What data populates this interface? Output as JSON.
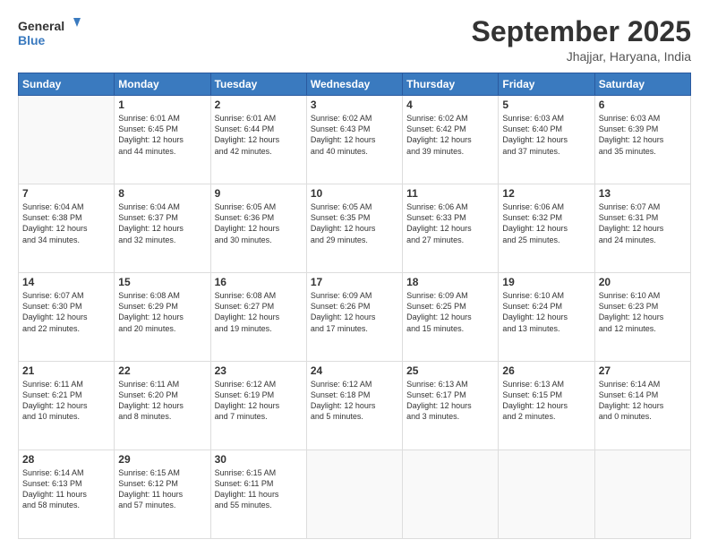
{
  "header": {
    "logo_general": "General",
    "logo_blue": "Blue",
    "month": "September 2025",
    "location": "Jhajjar, Haryana, India"
  },
  "weekdays": [
    "Sunday",
    "Monday",
    "Tuesday",
    "Wednesday",
    "Thursday",
    "Friday",
    "Saturday"
  ],
  "weeks": [
    [
      {
        "day": "",
        "info": ""
      },
      {
        "day": "1",
        "info": "Sunrise: 6:01 AM\nSunset: 6:45 PM\nDaylight: 12 hours\nand 44 minutes."
      },
      {
        "day": "2",
        "info": "Sunrise: 6:01 AM\nSunset: 6:44 PM\nDaylight: 12 hours\nand 42 minutes."
      },
      {
        "day": "3",
        "info": "Sunrise: 6:02 AM\nSunset: 6:43 PM\nDaylight: 12 hours\nand 40 minutes."
      },
      {
        "day": "4",
        "info": "Sunrise: 6:02 AM\nSunset: 6:42 PM\nDaylight: 12 hours\nand 39 minutes."
      },
      {
        "day": "5",
        "info": "Sunrise: 6:03 AM\nSunset: 6:40 PM\nDaylight: 12 hours\nand 37 minutes."
      },
      {
        "day": "6",
        "info": "Sunrise: 6:03 AM\nSunset: 6:39 PM\nDaylight: 12 hours\nand 35 minutes."
      }
    ],
    [
      {
        "day": "7",
        "info": "Sunrise: 6:04 AM\nSunset: 6:38 PM\nDaylight: 12 hours\nand 34 minutes."
      },
      {
        "day": "8",
        "info": "Sunrise: 6:04 AM\nSunset: 6:37 PM\nDaylight: 12 hours\nand 32 minutes."
      },
      {
        "day": "9",
        "info": "Sunrise: 6:05 AM\nSunset: 6:36 PM\nDaylight: 12 hours\nand 30 minutes."
      },
      {
        "day": "10",
        "info": "Sunrise: 6:05 AM\nSunset: 6:35 PM\nDaylight: 12 hours\nand 29 minutes."
      },
      {
        "day": "11",
        "info": "Sunrise: 6:06 AM\nSunset: 6:33 PM\nDaylight: 12 hours\nand 27 minutes."
      },
      {
        "day": "12",
        "info": "Sunrise: 6:06 AM\nSunset: 6:32 PM\nDaylight: 12 hours\nand 25 minutes."
      },
      {
        "day": "13",
        "info": "Sunrise: 6:07 AM\nSunset: 6:31 PM\nDaylight: 12 hours\nand 24 minutes."
      }
    ],
    [
      {
        "day": "14",
        "info": "Sunrise: 6:07 AM\nSunset: 6:30 PM\nDaylight: 12 hours\nand 22 minutes."
      },
      {
        "day": "15",
        "info": "Sunrise: 6:08 AM\nSunset: 6:29 PM\nDaylight: 12 hours\nand 20 minutes."
      },
      {
        "day": "16",
        "info": "Sunrise: 6:08 AM\nSunset: 6:27 PM\nDaylight: 12 hours\nand 19 minutes."
      },
      {
        "day": "17",
        "info": "Sunrise: 6:09 AM\nSunset: 6:26 PM\nDaylight: 12 hours\nand 17 minutes."
      },
      {
        "day": "18",
        "info": "Sunrise: 6:09 AM\nSunset: 6:25 PM\nDaylight: 12 hours\nand 15 minutes."
      },
      {
        "day": "19",
        "info": "Sunrise: 6:10 AM\nSunset: 6:24 PM\nDaylight: 12 hours\nand 13 minutes."
      },
      {
        "day": "20",
        "info": "Sunrise: 6:10 AM\nSunset: 6:23 PM\nDaylight: 12 hours\nand 12 minutes."
      }
    ],
    [
      {
        "day": "21",
        "info": "Sunrise: 6:11 AM\nSunset: 6:21 PM\nDaylight: 12 hours\nand 10 minutes."
      },
      {
        "day": "22",
        "info": "Sunrise: 6:11 AM\nSunset: 6:20 PM\nDaylight: 12 hours\nand 8 minutes."
      },
      {
        "day": "23",
        "info": "Sunrise: 6:12 AM\nSunset: 6:19 PM\nDaylight: 12 hours\nand 7 minutes."
      },
      {
        "day": "24",
        "info": "Sunrise: 6:12 AM\nSunset: 6:18 PM\nDaylight: 12 hours\nand 5 minutes."
      },
      {
        "day": "25",
        "info": "Sunrise: 6:13 AM\nSunset: 6:17 PM\nDaylight: 12 hours\nand 3 minutes."
      },
      {
        "day": "26",
        "info": "Sunrise: 6:13 AM\nSunset: 6:15 PM\nDaylight: 12 hours\nand 2 minutes."
      },
      {
        "day": "27",
        "info": "Sunrise: 6:14 AM\nSunset: 6:14 PM\nDaylight: 12 hours\nand 0 minutes."
      }
    ],
    [
      {
        "day": "28",
        "info": "Sunrise: 6:14 AM\nSunset: 6:13 PM\nDaylight: 11 hours\nand 58 minutes."
      },
      {
        "day": "29",
        "info": "Sunrise: 6:15 AM\nSunset: 6:12 PM\nDaylight: 11 hours\nand 57 minutes."
      },
      {
        "day": "30",
        "info": "Sunrise: 6:15 AM\nSunset: 6:11 PM\nDaylight: 11 hours\nand 55 minutes."
      },
      {
        "day": "",
        "info": ""
      },
      {
        "day": "",
        "info": ""
      },
      {
        "day": "",
        "info": ""
      },
      {
        "day": "",
        "info": ""
      }
    ]
  ]
}
